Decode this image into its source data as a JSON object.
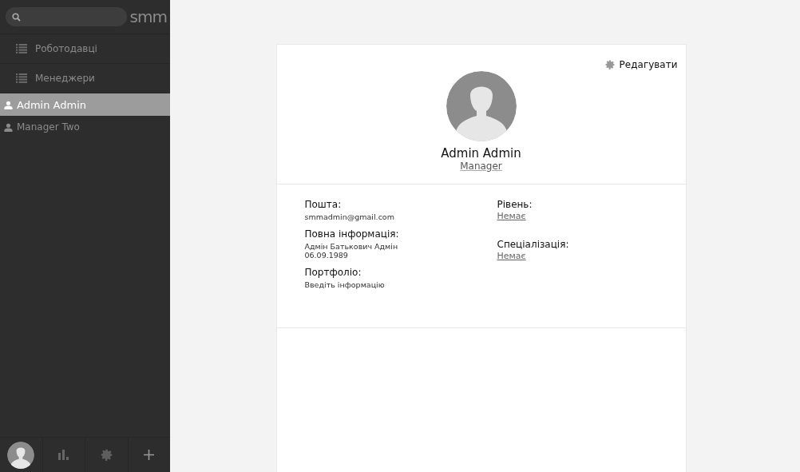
{
  "sidebar": {
    "logo": "smm",
    "nav": [
      {
        "kind": "section",
        "label": "Роботодавці",
        "selected": false
      },
      {
        "kind": "section",
        "label": "Менеджери",
        "selected": false
      },
      {
        "kind": "user",
        "label": "Admin Admin",
        "selected": true
      },
      {
        "kind": "user",
        "label": "Manager Two",
        "selected": false
      }
    ]
  },
  "profile": {
    "edit": "Редагувати",
    "name": "Admin Admin",
    "role": "Manager",
    "left": [
      {
        "label": "Пошта:",
        "kind": "text",
        "lines": [
          "smmadmin@gmail.com"
        ]
      },
      {
        "label": "Повна інформація:",
        "kind": "text",
        "lines": [
          "Адмін Батькович Адмін",
          "06.09.1989"
        ]
      },
      {
        "label": "Портфоліо:",
        "kind": "text",
        "lines": [
          "Введіть інформацію"
        ]
      }
    ],
    "right": [
      {
        "label": "Рівень:",
        "kind": "link",
        "lines": [
          "Немає"
        ]
      },
      {
        "label": "Спеціалізація:",
        "kind": "link",
        "lines": [
          "Немає"
        ]
      }
    ]
  }
}
